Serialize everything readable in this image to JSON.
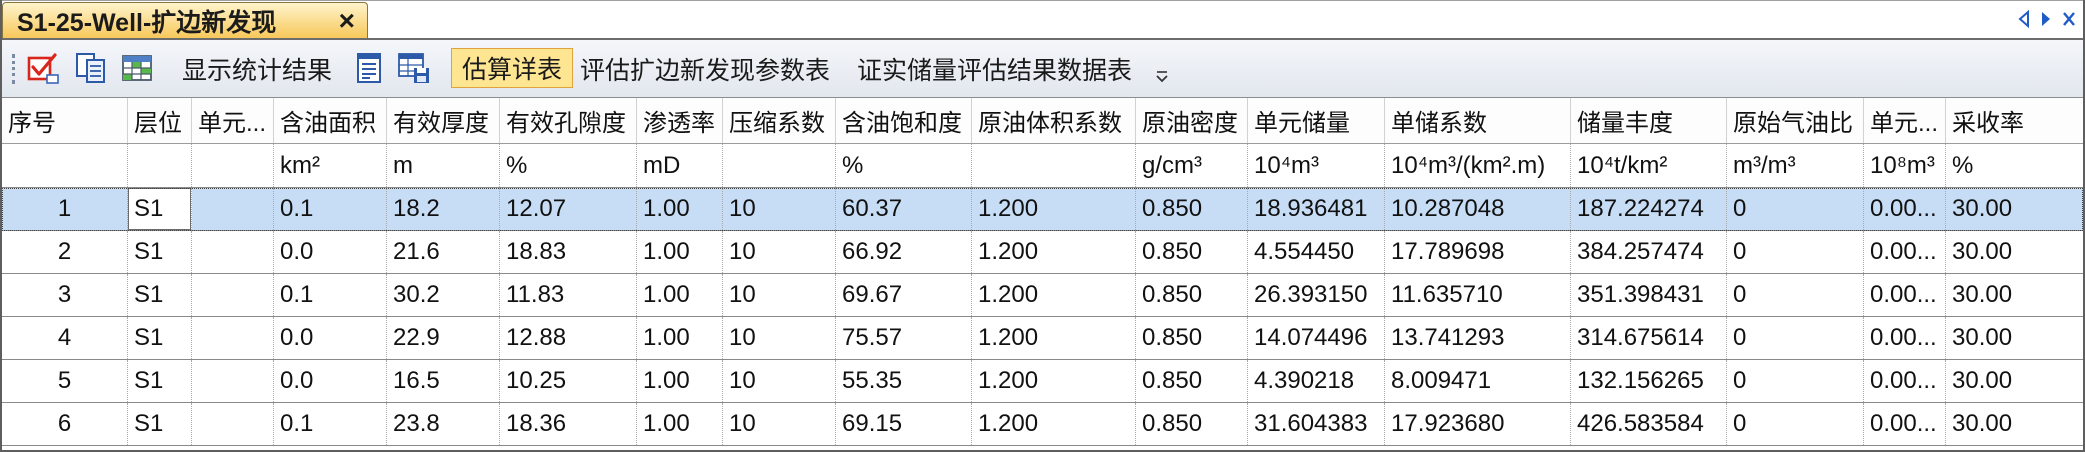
{
  "tab": {
    "title": "S1-25-Well-扩边新发现",
    "close_label": "×"
  },
  "icons": {
    "tab_scroll_left": "scroll-left-icon",
    "tab_scroll_right": "scroll-right-icon",
    "tab_close_all": "close-icon",
    "toolbar": [
      "check-list-icon",
      "copy-icon",
      "table-icon",
      "document-list-icon",
      "table-save-icon",
      "toolbar-overflow-icon"
    ]
  },
  "toolbar": {
    "show_stats": {
      "label": "显示统计结果",
      "active": false
    },
    "estimate_detail": {
      "label": "估算详表",
      "active": true
    },
    "eval_params": {
      "label": "评估扩边新发现参数表",
      "active": false
    },
    "proven_reserves": {
      "label": "证实储量评估结果数据表",
      "active": false
    }
  },
  "table": {
    "columns": [
      {
        "header": "序号",
        "unit": ""
      },
      {
        "header": "层位",
        "unit": ""
      },
      {
        "header": "单元...",
        "unit": ""
      },
      {
        "header": "含油面积",
        "unit": "km²"
      },
      {
        "header": "有效厚度",
        "unit": "m"
      },
      {
        "header": "有效孔隙度",
        "unit": "%"
      },
      {
        "header": "渗透率",
        "unit": "mD"
      },
      {
        "header": "压缩系数",
        "unit": ""
      },
      {
        "header": "含油饱和度",
        "unit": "%"
      },
      {
        "header": "原油体积系数",
        "unit": ""
      },
      {
        "header": "原油密度",
        "unit": "g/cm³"
      },
      {
        "header": "单元储量",
        "unit": "10⁴m³"
      },
      {
        "header": "单储系数",
        "unit": "10⁴m³/(km².m)"
      },
      {
        "header": "储量丰度",
        "unit": "10⁴t/km²"
      },
      {
        "header": "原始气油比",
        "unit": "m³/m³"
      },
      {
        "header": "单元...",
        "unit": "10⁸m³"
      },
      {
        "header": "采收率",
        "unit": "%"
      }
    ],
    "rows": [
      [
        "1",
        "S1",
        "",
        "0.1",
        "18.2",
        "12.07",
        "1.00",
        "10",
        "60.37",
        "1.200",
        "0.850",
        "18.936481",
        "10.287048",
        "187.224274",
        "0",
        "0.00...",
        "30.00"
      ],
      [
        "2",
        "S1",
        "",
        "0.0",
        "21.6",
        "18.83",
        "1.00",
        "10",
        "66.92",
        "1.200",
        "0.850",
        "4.554450",
        "17.789698",
        "384.257474",
        "0",
        "0.00...",
        "30.00"
      ],
      [
        "3",
        "S1",
        "",
        "0.1",
        "30.2",
        "11.83",
        "1.00",
        "10",
        "69.67",
        "1.200",
        "0.850",
        "26.393150",
        "11.635710",
        "351.398431",
        "0",
        "0.00...",
        "30.00"
      ],
      [
        "4",
        "S1",
        "",
        "0.0",
        "22.9",
        "12.88",
        "1.00",
        "10",
        "75.57",
        "1.200",
        "0.850",
        "14.074496",
        "13.741293",
        "314.675614",
        "0",
        "0.00...",
        "30.00"
      ],
      [
        "5",
        "S1",
        "",
        "0.0",
        "16.5",
        "10.25",
        "1.00",
        "10",
        "55.35",
        "1.200",
        "0.850",
        "4.390218",
        "8.009471",
        "132.156265",
        "0",
        "0.00...",
        "30.00"
      ],
      [
        "6",
        "S1",
        "",
        "0.1",
        "23.8",
        "18.36",
        "1.00",
        "10",
        "69.15",
        "1.200",
        "0.850",
        "31.604383",
        "17.923680",
        "426.583584",
        "0",
        "0.00...",
        "30.00"
      ]
    ],
    "selection": {
      "row": 0,
      "column": 1
    }
  },
  "colors": {
    "selected_row": "#c7ddf5",
    "active_button_bg": "#fee592",
    "active_button_border": "#e2a33c",
    "tab_top": "#fff4cc",
    "tab_bottom": "#f7c85a",
    "nav_icon": "#1f5cc5",
    "toolbar_top": "#f4f6fa",
    "toolbar_bottom": "#e2e7ee"
  }
}
